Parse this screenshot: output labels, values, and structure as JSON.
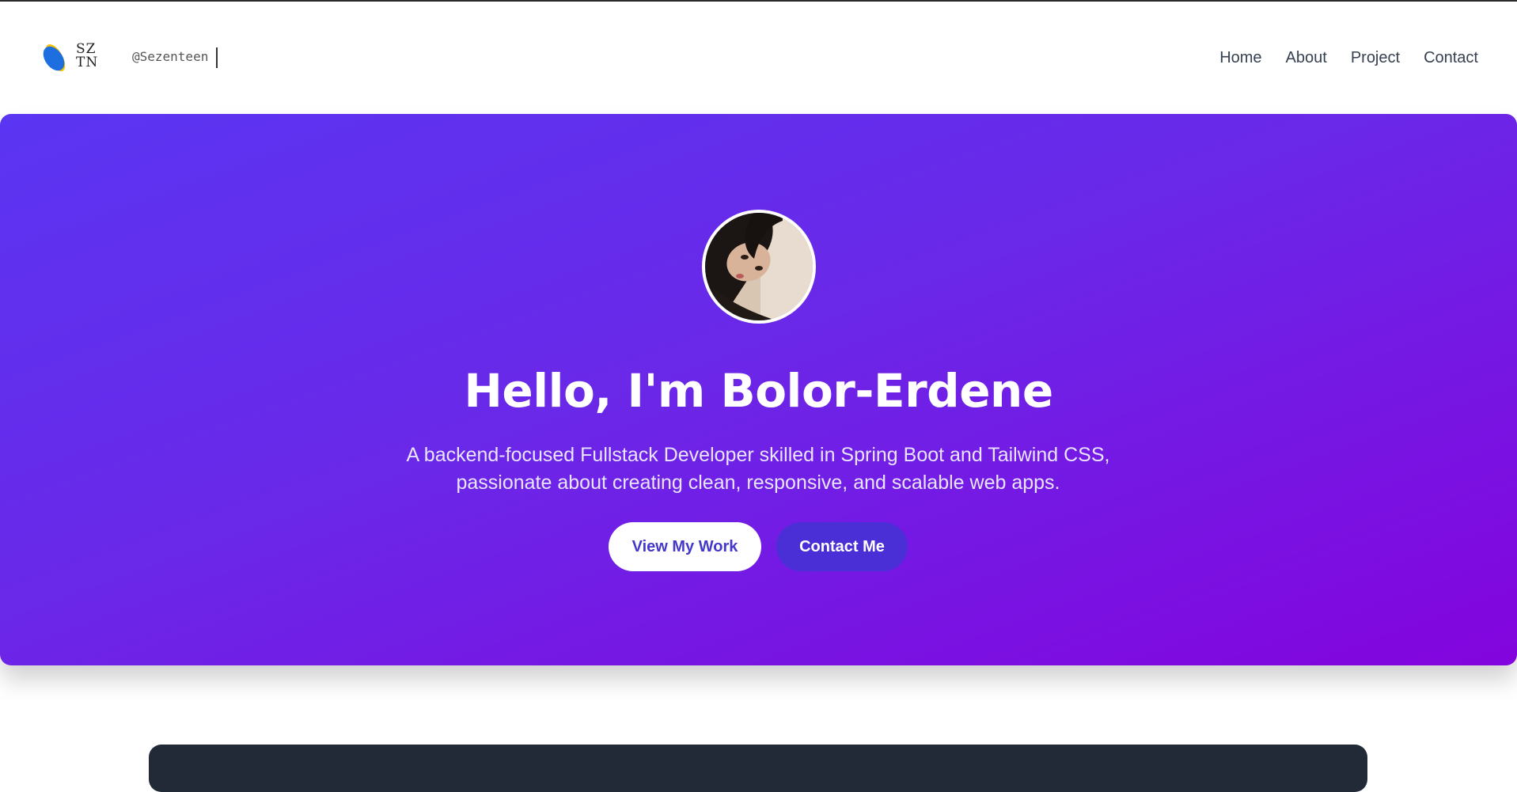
{
  "header": {
    "logo_text_line1": "SZ",
    "logo_text_line2": "TN",
    "handle": "@Sezenteen",
    "nav": [
      "Home",
      "About",
      "Project",
      "Contact"
    ]
  },
  "hero": {
    "title": "Hello, I'm Bolor-Erdene",
    "subtitle_line1": "A backend-focused Fullstack Developer skilled in Spring Boot and Tailwind CSS,",
    "subtitle_line2": "passionate about creating clean, responsive, and scalable web apps.",
    "primary_button": "View My Work",
    "secondary_button": "Contact Me"
  },
  "colors": {
    "gradient_start": "#5a35f2",
    "gradient_end": "#8304de",
    "primary_button_text": "#4338ca",
    "secondary_button_bg": "#4a2fd6",
    "dark_panel": "#222a38"
  },
  "icons": {
    "logo": "sztn-logo-icon",
    "avatar": "profile-photo"
  }
}
